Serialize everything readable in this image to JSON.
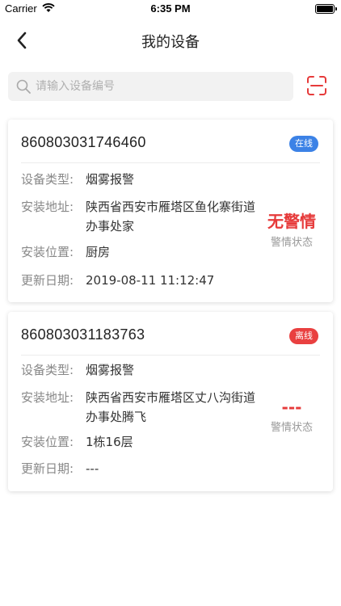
{
  "status_bar": {
    "carrier": "Carrier",
    "time": "6:35 PM"
  },
  "nav": {
    "title": "我的设备",
    "back_icon": "chevron-left-icon"
  },
  "search": {
    "placeholder": "请输入设备编号",
    "value": "",
    "scan_icon": "scan-icon"
  },
  "colors": {
    "online": "#3c82e6",
    "offline": "#e94040",
    "alarm": "#e63a3a"
  },
  "devices": [
    {
      "id": "860803031746460",
      "status": "在线",
      "type_label": "设备类型:",
      "type": "烟雾报警",
      "address_label": "安装地址:",
      "address": "陕西省西安市雁塔区鱼化寨街道办事处家",
      "location_label": "安装位置:",
      "location": "厨房",
      "updated_label": "更新日期:",
      "updated": "2019-08-11 11:12:47",
      "alarm_value": "无警情",
      "alarm_label": "警情状态"
    },
    {
      "id": "860803031183763",
      "status": "离线",
      "type_label": "设备类型:",
      "type": "烟雾报警",
      "address_label": "安装地址:",
      "address": "陕西省西安市雁塔区丈八沟街道办事处腾飞",
      "location_label": "安装位置:",
      "location": "1栋16层",
      "updated_label": "更新日期:",
      "updated": "---",
      "alarm_value": "---",
      "alarm_label": "警情状态"
    }
  ]
}
